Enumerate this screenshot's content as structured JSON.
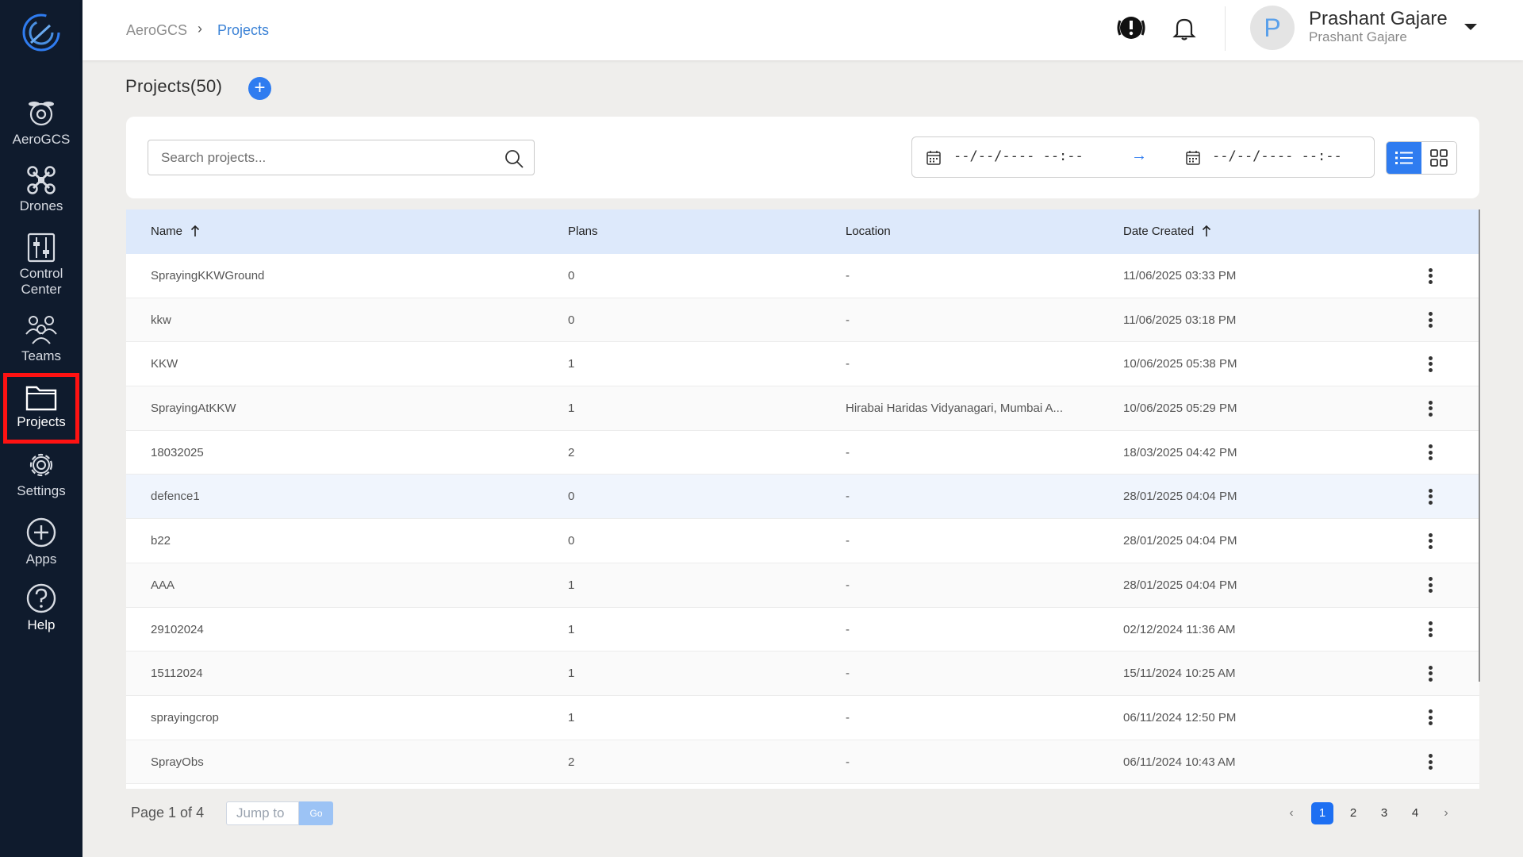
{
  "sidebar": {
    "items": [
      {
        "label": "AeroGCS",
        "icon": "drone-eye-icon"
      },
      {
        "label": "Drones",
        "icon": "quadcopter-icon"
      },
      {
        "label": "Control\nCenter",
        "icon": "sliders-icon"
      },
      {
        "label": "Teams",
        "icon": "team-icon"
      },
      {
        "label": "Projects",
        "icon": "folder-icon",
        "active": true
      },
      {
        "label": "Settings",
        "icon": "gear-icon"
      },
      {
        "label": "Apps",
        "icon": "plus-circle-icon"
      },
      {
        "label": "Help",
        "icon": "help-circle-icon"
      }
    ]
  },
  "header": {
    "breadcrumb_root": "AeroGCS",
    "breadcrumb_current": "Projects",
    "user_name": "Prashant Gajare",
    "user_sub": "Prashant Gajare",
    "avatar_initial": "P"
  },
  "page": {
    "title": "Projects(50)",
    "add_label": "+"
  },
  "filters": {
    "search_placeholder": "Search projects...",
    "date_from": "--/--/---- --:--",
    "date_to": "--/--/---- --:--",
    "date_arrow": "→"
  },
  "table": {
    "columns": {
      "name": "Name",
      "plans": "Plans",
      "location": "Location",
      "date": "Date Created"
    },
    "rows": [
      {
        "name": "SprayingKKWGround",
        "plans": "0",
        "location": "-",
        "date": "11/06/2025 03:33 PM"
      },
      {
        "name": "kkw",
        "plans": "0",
        "location": "-",
        "date": "11/06/2025 03:18 PM"
      },
      {
        "name": "KKW",
        "plans": "1",
        "location": "-",
        "date": "10/06/2025 05:38 PM"
      },
      {
        "name": "SprayingAtKKW",
        "plans": "1",
        "location": "Hirabai Haridas Vidyanagari, Mumbai A...",
        "date": "10/06/2025 05:29 PM"
      },
      {
        "name": "18032025",
        "plans": "2",
        "location": "-",
        "date": "18/03/2025 04:42 PM"
      },
      {
        "name": "defence1",
        "plans": "0",
        "location": "-",
        "date": "28/01/2025 04:04 PM"
      },
      {
        "name": "b22",
        "plans": "0",
        "location": "-",
        "date": "28/01/2025 04:04 PM"
      },
      {
        "name": "AAA",
        "plans": "1",
        "location": "-",
        "date": "28/01/2025 04:04 PM"
      },
      {
        "name": "29102024",
        "plans": "1",
        "location": "-",
        "date": "02/12/2024 11:36 AM"
      },
      {
        "name": "15112024",
        "plans": "1",
        "location": "-",
        "date": "15/11/2024 10:25 AM"
      },
      {
        "name": "sprayingcrop",
        "plans": "1",
        "location": "-",
        "date": "06/11/2024 12:50 PM"
      },
      {
        "name": "SprayObs",
        "plans": "2",
        "location": "-",
        "date": "06/11/2024 10:43 AM"
      }
    ]
  },
  "pagination": {
    "info": "Page 1 of 4",
    "jump_placeholder": "Jump to",
    "go_label": "Go",
    "prev": "‹",
    "next": "›",
    "pages": [
      "1",
      "2",
      "3",
      "4"
    ],
    "current": "1"
  },
  "colors": {
    "sidebar_bg": "#0f1b2d",
    "accent": "#2f7cf0",
    "active_outline": "#ff1212",
    "table_header_bg": "#dde9fb"
  }
}
